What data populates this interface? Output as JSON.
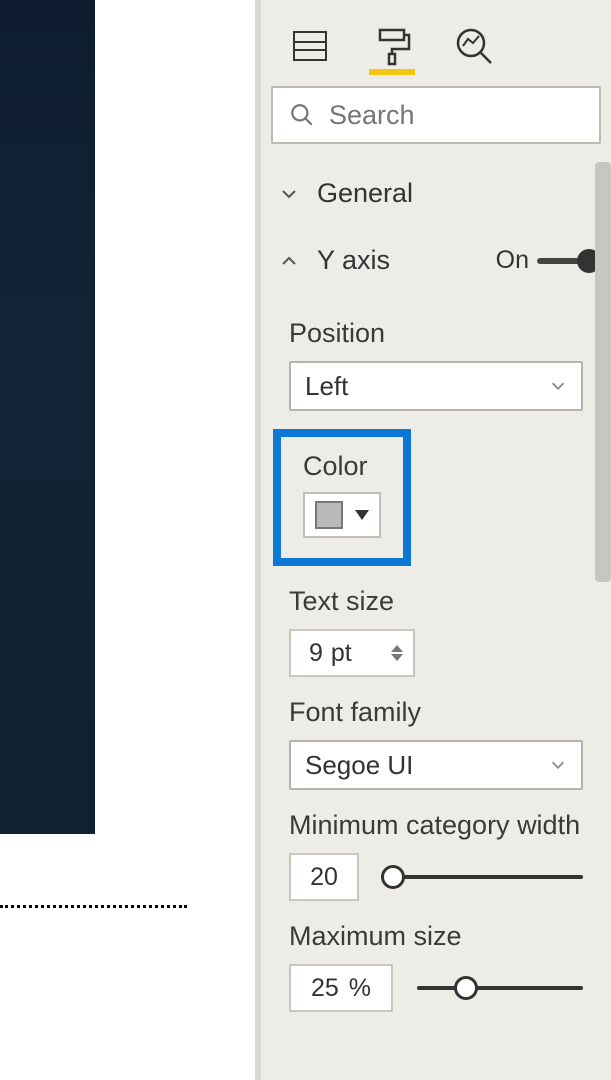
{
  "search": {
    "placeholder": "Search"
  },
  "sections": {
    "general": {
      "title": "General"
    },
    "y_axis": {
      "title": "Y axis",
      "toggle_label": "On",
      "position": {
        "label": "Position",
        "value": "Left"
      },
      "color": {
        "label": "Color",
        "swatch": "#b9b9b9"
      },
      "text_size": {
        "label": "Text size",
        "value": "9",
        "unit": "pt"
      },
      "font_family": {
        "label": "Font family",
        "value": "Segoe UI"
      },
      "min_category_width": {
        "label": "Minimum category width",
        "value": "20"
      },
      "max_size": {
        "label": "Maximum size",
        "value": "25",
        "unit": "%"
      }
    }
  }
}
